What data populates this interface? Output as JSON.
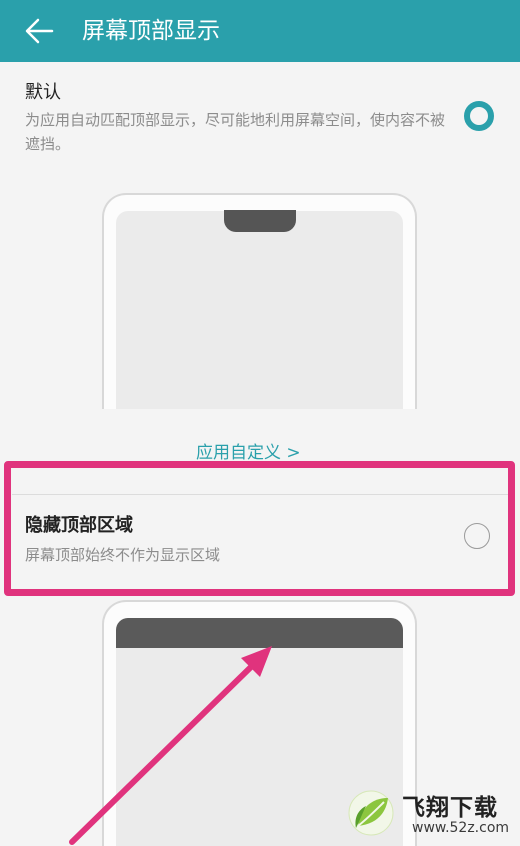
{
  "appbar": {
    "back_icon": "arrow-left-icon",
    "title": "屏幕顶部显示"
  },
  "options": [
    {
      "title": "默认",
      "description": "为应用自动匹配顶部显示，尽可能地利用屏幕空间，使内容不被遮挡。",
      "selected": true
    },
    {
      "title": "隐藏顶部区域",
      "description": "屏幕顶部始终不作为显示区域",
      "selected": false
    }
  ],
  "links": {
    "app_custom": "应用自定义 >"
  },
  "colors": {
    "accent": "#2aa0ab",
    "highlight": "#e0337d"
  },
  "watermark": {
    "brand": "飞翔下载",
    "url": "www.52z.com"
  }
}
